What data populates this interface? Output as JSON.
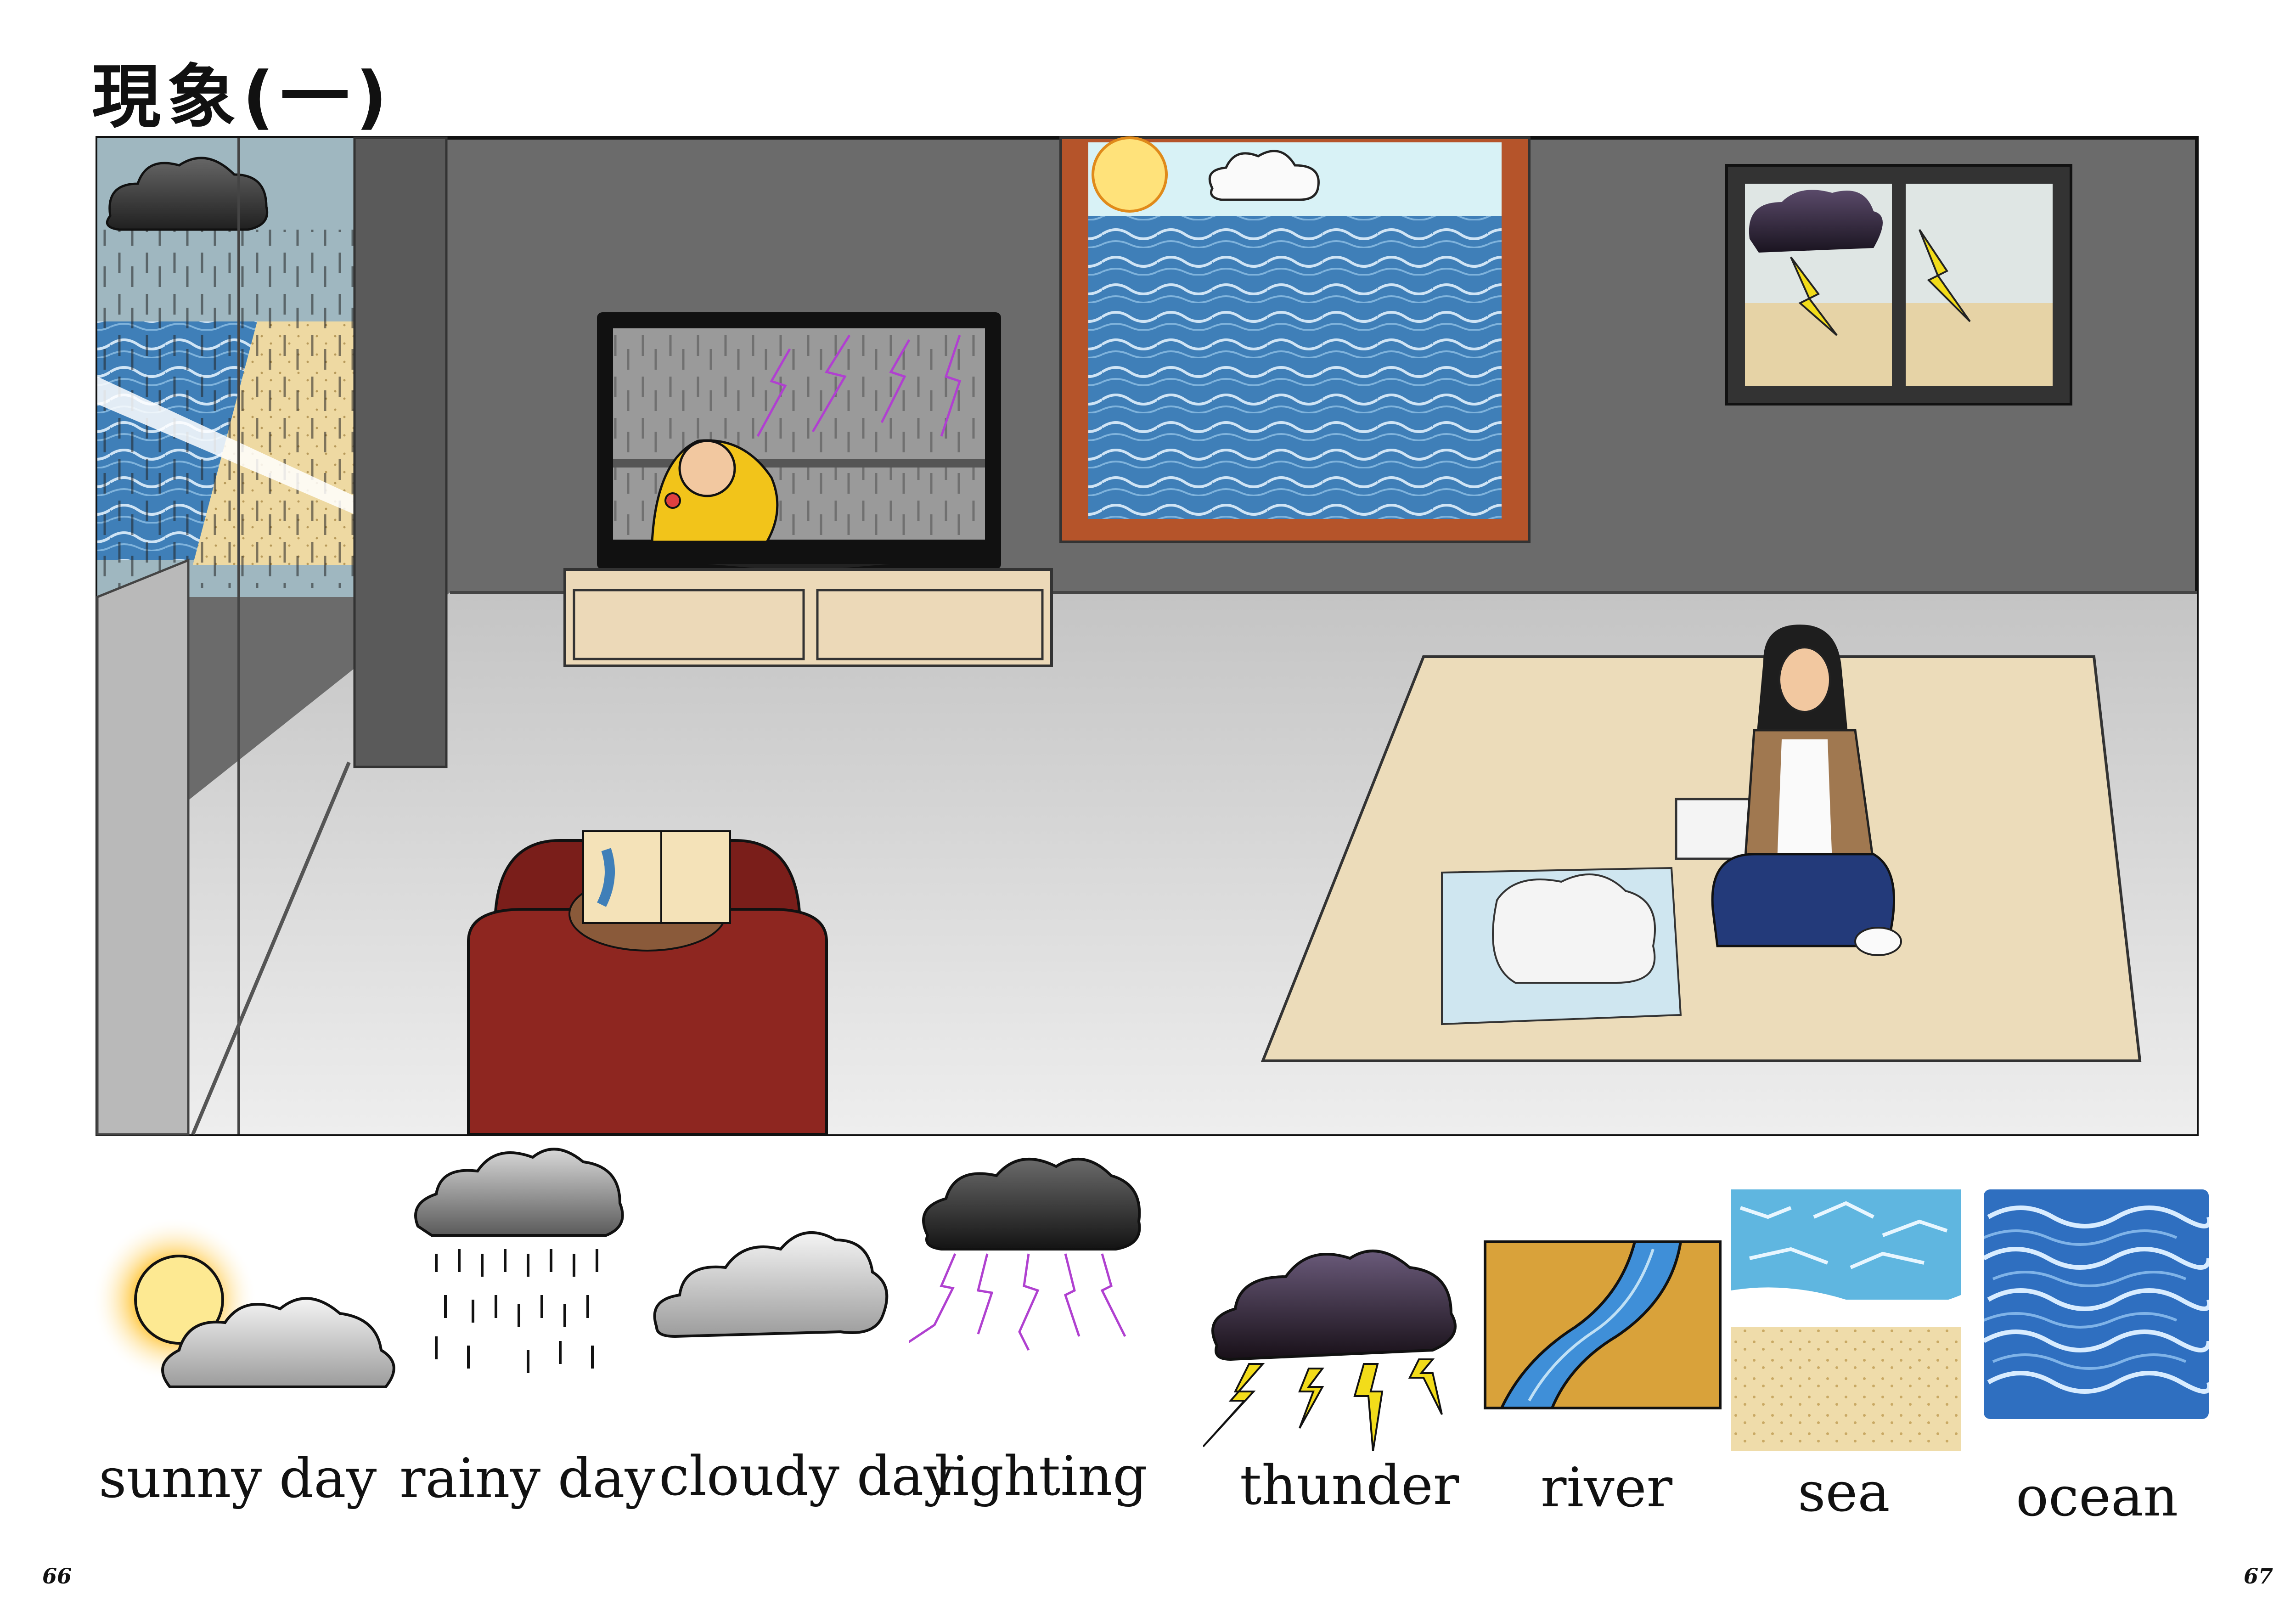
{
  "page": {
    "title": "現象(一)",
    "left_page_number": "66",
    "right_page_number": "67"
  },
  "vocabulary": [
    {
      "id": "sunny",
      "label": "sunny day",
      "icon": "sun-cloud-icon"
    },
    {
      "id": "rainy",
      "label": "rainy day",
      "icon": "rain-cloud-icon"
    },
    {
      "id": "cloudy",
      "label": "cloudy day",
      "icon": "cloud-icon"
    },
    {
      "id": "lighting",
      "label": "lighting",
      "icon": "lightning-cloud-icon"
    },
    {
      "id": "thunder",
      "label": "thunder",
      "icon": "thunder-cloud-icon"
    },
    {
      "id": "river",
      "label": "river",
      "icon": "river-icon"
    },
    {
      "id": "sea",
      "label": "sea",
      "icon": "sea-icon"
    },
    {
      "id": "ocean",
      "label": "ocean",
      "icon": "ocean-icon"
    }
  ],
  "colors": {
    "wall": "#6b6b6b",
    "floor": "#cfcfcf",
    "rug": "#ecdcba",
    "sofa": "#8e2620",
    "cabinet": "#ecd9b8",
    "sun": "#ffe27a",
    "water": "#3f7fb8",
    "lightning_purple": "#b040d0",
    "bolt_yellow": "#f2dc1a"
  }
}
